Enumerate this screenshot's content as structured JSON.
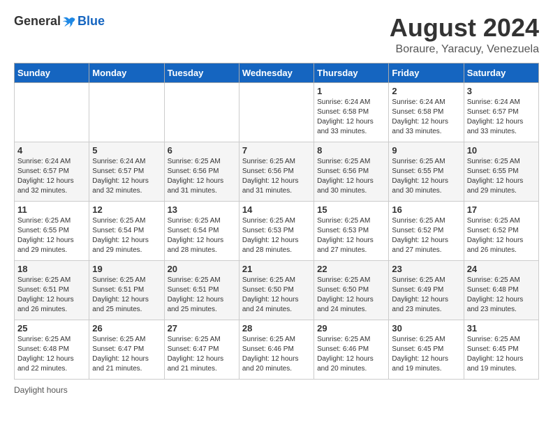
{
  "logo": {
    "general": "General",
    "blue": "Blue"
  },
  "header": {
    "month_year": "August 2024",
    "location": "Boraure, Yaracuy, Venezuela"
  },
  "footer": {
    "note": "Daylight hours"
  },
  "days_of_week": [
    "Sunday",
    "Monday",
    "Tuesday",
    "Wednesday",
    "Thursday",
    "Friday",
    "Saturday"
  ],
  "weeks": [
    [
      {
        "num": "",
        "info": ""
      },
      {
        "num": "",
        "info": ""
      },
      {
        "num": "",
        "info": ""
      },
      {
        "num": "",
        "info": ""
      },
      {
        "num": "1",
        "info": "Sunrise: 6:24 AM\nSunset: 6:58 PM\nDaylight: 12 hours\nand 33 minutes."
      },
      {
        "num": "2",
        "info": "Sunrise: 6:24 AM\nSunset: 6:58 PM\nDaylight: 12 hours\nand 33 minutes."
      },
      {
        "num": "3",
        "info": "Sunrise: 6:24 AM\nSunset: 6:57 PM\nDaylight: 12 hours\nand 33 minutes."
      }
    ],
    [
      {
        "num": "4",
        "info": "Sunrise: 6:24 AM\nSunset: 6:57 PM\nDaylight: 12 hours\nand 32 minutes."
      },
      {
        "num": "5",
        "info": "Sunrise: 6:24 AM\nSunset: 6:57 PM\nDaylight: 12 hours\nand 32 minutes."
      },
      {
        "num": "6",
        "info": "Sunrise: 6:25 AM\nSunset: 6:56 PM\nDaylight: 12 hours\nand 31 minutes."
      },
      {
        "num": "7",
        "info": "Sunrise: 6:25 AM\nSunset: 6:56 PM\nDaylight: 12 hours\nand 31 minutes."
      },
      {
        "num": "8",
        "info": "Sunrise: 6:25 AM\nSunset: 6:56 PM\nDaylight: 12 hours\nand 30 minutes."
      },
      {
        "num": "9",
        "info": "Sunrise: 6:25 AM\nSunset: 6:55 PM\nDaylight: 12 hours\nand 30 minutes."
      },
      {
        "num": "10",
        "info": "Sunrise: 6:25 AM\nSunset: 6:55 PM\nDaylight: 12 hours\nand 29 minutes."
      }
    ],
    [
      {
        "num": "11",
        "info": "Sunrise: 6:25 AM\nSunset: 6:55 PM\nDaylight: 12 hours\nand 29 minutes."
      },
      {
        "num": "12",
        "info": "Sunrise: 6:25 AM\nSunset: 6:54 PM\nDaylight: 12 hours\nand 29 minutes."
      },
      {
        "num": "13",
        "info": "Sunrise: 6:25 AM\nSunset: 6:54 PM\nDaylight: 12 hours\nand 28 minutes."
      },
      {
        "num": "14",
        "info": "Sunrise: 6:25 AM\nSunset: 6:53 PM\nDaylight: 12 hours\nand 28 minutes."
      },
      {
        "num": "15",
        "info": "Sunrise: 6:25 AM\nSunset: 6:53 PM\nDaylight: 12 hours\nand 27 minutes."
      },
      {
        "num": "16",
        "info": "Sunrise: 6:25 AM\nSunset: 6:52 PM\nDaylight: 12 hours\nand 27 minutes."
      },
      {
        "num": "17",
        "info": "Sunrise: 6:25 AM\nSunset: 6:52 PM\nDaylight: 12 hours\nand 26 minutes."
      }
    ],
    [
      {
        "num": "18",
        "info": "Sunrise: 6:25 AM\nSunset: 6:51 PM\nDaylight: 12 hours\nand 26 minutes."
      },
      {
        "num": "19",
        "info": "Sunrise: 6:25 AM\nSunset: 6:51 PM\nDaylight: 12 hours\nand 25 minutes."
      },
      {
        "num": "20",
        "info": "Sunrise: 6:25 AM\nSunset: 6:51 PM\nDaylight: 12 hours\nand 25 minutes."
      },
      {
        "num": "21",
        "info": "Sunrise: 6:25 AM\nSunset: 6:50 PM\nDaylight: 12 hours\nand 24 minutes."
      },
      {
        "num": "22",
        "info": "Sunrise: 6:25 AM\nSunset: 6:50 PM\nDaylight: 12 hours\nand 24 minutes."
      },
      {
        "num": "23",
        "info": "Sunrise: 6:25 AM\nSunset: 6:49 PM\nDaylight: 12 hours\nand 23 minutes."
      },
      {
        "num": "24",
        "info": "Sunrise: 6:25 AM\nSunset: 6:48 PM\nDaylight: 12 hours\nand 23 minutes."
      }
    ],
    [
      {
        "num": "25",
        "info": "Sunrise: 6:25 AM\nSunset: 6:48 PM\nDaylight: 12 hours\nand 22 minutes."
      },
      {
        "num": "26",
        "info": "Sunrise: 6:25 AM\nSunset: 6:47 PM\nDaylight: 12 hours\nand 21 minutes."
      },
      {
        "num": "27",
        "info": "Sunrise: 6:25 AM\nSunset: 6:47 PM\nDaylight: 12 hours\nand 21 minutes."
      },
      {
        "num": "28",
        "info": "Sunrise: 6:25 AM\nSunset: 6:46 PM\nDaylight: 12 hours\nand 20 minutes."
      },
      {
        "num": "29",
        "info": "Sunrise: 6:25 AM\nSunset: 6:46 PM\nDaylight: 12 hours\nand 20 minutes."
      },
      {
        "num": "30",
        "info": "Sunrise: 6:25 AM\nSunset: 6:45 PM\nDaylight: 12 hours\nand 19 minutes."
      },
      {
        "num": "31",
        "info": "Sunrise: 6:25 AM\nSunset: 6:45 PM\nDaylight: 12 hours\nand 19 minutes."
      }
    ]
  ]
}
